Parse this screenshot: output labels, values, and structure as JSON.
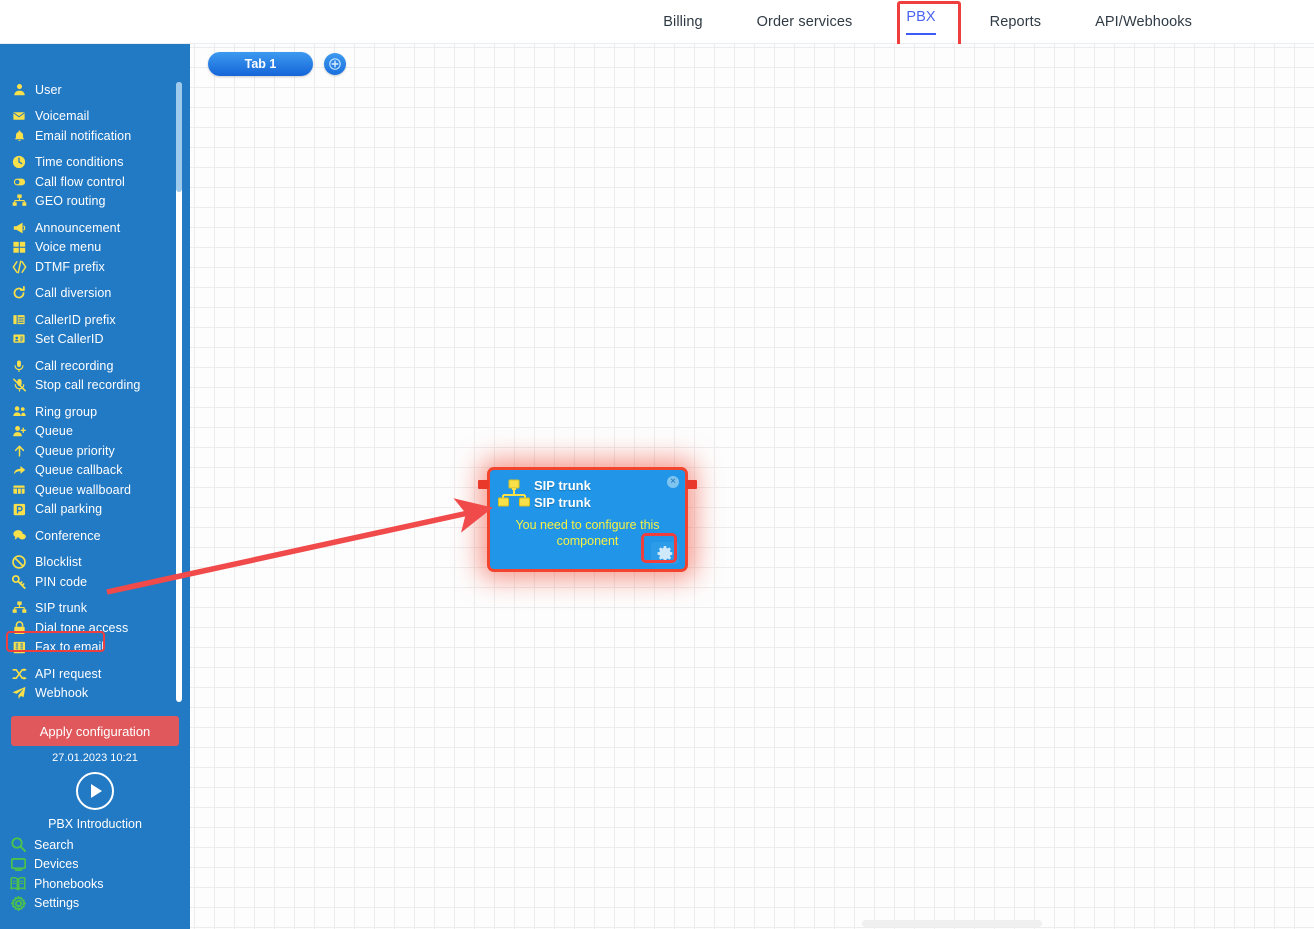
{
  "topnav": {
    "items": [
      {
        "label": "Billing",
        "active": false
      },
      {
        "label": "Order services",
        "active": false
      },
      {
        "label": "PBX",
        "active": true
      },
      {
        "label": "Reports",
        "active": false
      },
      {
        "label": "API/Webhooks",
        "active": false
      }
    ]
  },
  "sidebar": {
    "groups": [
      {
        "items": [
          {
            "label": "User",
            "icon": "user-icon"
          }
        ]
      },
      {
        "items": [
          {
            "label": "Voicemail",
            "icon": "envelope-icon"
          },
          {
            "label": "Email notification",
            "icon": "bell-icon"
          }
        ]
      },
      {
        "items": [
          {
            "label": "Time conditions",
            "icon": "clock-icon"
          },
          {
            "label": "Call flow control",
            "icon": "toggle-icon"
          },
          {
            "label": "GEO routing",
            "icon": "sitemap-icon"
          }
        ]
      },
      {
        "items": [
          {
            "label": "Announcement",
            "icon": "megaphone-icon"
          },
          {
            "label": "Voice menu",
            "icon": "grid-icon"
          },
          {
            "label": "DTMF prefix",
            "icon": "code-icon"
          }
        ]
      },
      {
        "items": [
          {
            "label": "Call diversion",
            "icon": "refresh-icon"
          }
        ]
      },
      {
        "items": [
          {
            "label": "CallerID prefix",
            "icon": "list-icon"
          },
          {
            "label": "Set CallerID",
            "icon": "idcard-icon"
          }
        ]
      },
      {
        "items": [
          {
            "label": "Call recording",
            "icon": "microphone-icon"
          },
          {
            "label": "Stop call recording",
            "icon": "microphone-slash-icon"
          }
        ]
      },
      {
        "items": [
          {
            "label": "Ring group",
            "icon": "users-icon"
          },
          {
            "label": "Queue",
            "icon": "user-plus-icon"
          },
          {
            "label": "Queue priority",
            "icon": "arrow-up-icon"
          },
          {
            "label": "Queue callback",
            "icon": "share-icon"
          },
          {
            "label": "Queue wallboard",
            "icon": "wallboard-icon"
          },
          {
            "label": "Call parking",
            "icon": "parking-icon"
          }
        ]
      },
      {
        "items": [
          {
            "label": "Conference",
            "icon": "comments-icon"
          }
        ]
      },
      {
        "items": [
          {
            "label": "Blocklist",
            "icon": "ban-icon"
          },
          {
            "label": "PIN code",
            "icon": "key-icon"
          }
        ]
      },
      {
        "items": [
          {
            "label": "SIP trunk",
            "icon": "sitemap-icon",
            "highlighted": true
          },
          {
            "label": "Dial tone access",
            "icon": "lock-icon"
          },
          {
            "label": "Fax to email",
            "icon": "fax-icon"
          }
        ]
      },
      {
        "items": [
          {
            "label": "API request",
            "icon": "shuffle-icon"
          },
          {
            "label": "Webhook",
            "icon": "paper-plane-icon"
          }
        ]
      }
    ],
    "apply_button": "Apply configuration",
    "timestamp": "27.01.2023 10:21",
    "intro_label": "PBX Introduction",
    "bottom_items": [
      {
        "label": "Search",
        "icon": "search-icon"
      },
      {
        "label": "Devices",
        "icon": "monitor-icon"
      },
      {
        "label": "Phonebooks",
        "icon": "book-icon"
      },
      {
        "label": "Settings",
        "icon": "gear-icon"
      }
    ]
  },
  "canvas": {
    "tab_label": "Tab 1",
    "add_tab_label": "+",
    "node": {
      "icon": "sitemap-icon",
      "title": "SIP trunk",
      "subtitle": "SIP trunk",
      "warning": "You need to configure this component",
      "close_label": "×",
      "gear_icon": "gear-icon"
    }
  },
  "colors": {
    "sidebar_blue": "#2279c4",
    "node_blue": "#2196e8",
    "annotation_red": "#ef3e3e",
    "apply_red": "#e0585c",
    "icon_yellow": "#f7e04a",
    "bottom_icon_green": "#4cc24c",
    "warning_yellow": "#f6f142",
    "active_tab_blue": "#4a63f0"
  }
}
